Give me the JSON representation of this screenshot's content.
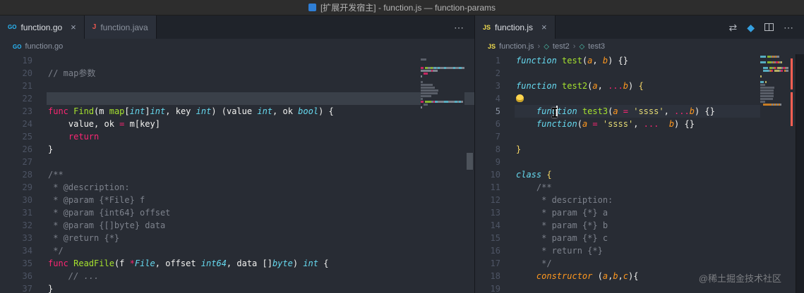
{
  "titlebar": {
    "title": "[扩展开发宿主] - function.js — function-params"
  },
  "watermark": "@稀土掘金技术社区",
  "glyphs": {
    "close": "×",
    "more": "⋯",
    "chevron": "›",
    "compare": "⇄",
    "diamond": "◆",
    "symbol": "◇",
    "go": "GO",
    "js": "JS",
    "java": "J"
  },
  "left": {
    "tabs": [
      {
        "label": "function.go"
      },
      {
        "label": "function.java"
      }
    ],
    "breadcrumb": {
      "file": "function.go"
    },
    "code": {
      "lines": [
        {
          "n": 19,
          "t": []
        },
        {
          "n": 20,
          "t": [
            [
              "// map参数",
              "cm"
            ]
          ]
        },
        {
          "n": 21,
          "t": []
        },
        {
          "n": 22,
          "hl": "sel",
          "t": []
        },
        {
          "n": 23,
          "t": [
            [
              "func",
              "k"
            ],
            [
              " ",
              "p"
            ],
            [
              "Find",
              "fn"
            ],
            [
              "(m ",
              "p"
            ],
            [
              "map",
              "fn"
            ],
            [
              "[",
              "p"
            ],
            [
              "int",
              "ty"
            ],
            [
              "]",
              "p"
            ],
            [
              "int",
              "ty"
            ],
            [
              ", key ",
              "p"
            ],
            [
              "int",
              "ty"
            ],
            [
              ") (value ",
              "p"
            ],
            [
              "int",
              "ty"
            ],
            [
              ", ok ",
              "p"
            ],
            [
              "bool",
              "ty"
            ],
            [
              ") {",
              "p"
            ]
          ]
        },
        {
          "n": 24,
          "t": [
            [
              "    value, ok ",
              "p"
            ],
            [
              "=",
              "k"
            ],
            [
              " m[key]",
              "p"
            ]
          ]
        },
        {
          "n": 25,
          "t": [
            [
              "    ",
              "p"
            ],
            [
              "return",
              "k"
            ]
          ]
        },
        {
          "n": 26,
          "t": [
            [
              "}",
              "p"
            ]
          ]
        },
        {
          "n": 27,
          "t": []
        },
        {
          "n": 28,
          "t": [
            [
              "/**",
              "cm"
            ]
          ]
        },
        {
          "n": 29,
          "t": [
            [
              " * @description:",
              "cm"
            ]
          ]
        },
        {
          "n": 30,
          "t": [
            [
              " * @param {*File} f",
              "cm"
            ]
          ]
        },
        {
          "n": 31,
          "t": [
            [
              " * @param {int64} offset",
              "cm"
            ]
          ]
        },
        {
          "n": 32,
          "t": [
            [
              " * @param {[]byte} data",
              "cm"
            ]
          ]
        },
        {
          "n": 33,
          "t": [
            [
              " * @return {*}",
              "cm"
            ]
          ]
        },
        {
          "n": 34,
          "t": [
            [
              " */",
              "cm"
            ]
          ]
        },
        {
          "n": 35,
          "t": [
            [
              "func",
              "k"
            ],
            [
              " ",
              "p"
            ],
            [
              "ReadFile",
              "fn"
            ],
            [
              "(f ",
              "p"
            ],
            [
              "*",
              "k"
            ],
            [
              "File",
              "ty"
            ],
            [
              ", offset ",
              "p"
            ],
            [
              "int64",
              "ty"
            ],
            [
              ", data []",
              "p"
            ],
            [
              "byte",
              "ty"
            ],
            [
              ") ",
              "p"
            ],
            [
              "int",
              "ty"
            ],
            [
              " {",
              "p"
            ]
          ]
        },
        {
          "n": 36,
          "t": [
            [
              "    ",
              "p"
            ],
            [
              "// ...",
              "cmi"
            ]
          ]
        },
        {
          "n": 37,
          "t": [
            [
              "}",
              "p"
            ]
          ]
        }
      ]
    }
  },
  "right": {
    "tab": {
      "label": "function.js"
    },
    "breadcrumb": {
      "file": "function.js",
      "sym1": "test2",
      "sym2": "test3"
    },
    "code": {
      "lines": [
        {
          "n": 1,
          "t": [
            [
              "function",
              "kwi"
            ],
            [
              " ",
              "p"
            ],
            [
              "test",
              "fn"
            ],
            [
              "(",
              "p"
            ],
            [
              "a",
              "pr"
            ],
            [
              ", ",
              "p"
            ],
            [
              "b",
              "pr"
            ],
            [
              ") {}",
              "p"
            ]
          ]
        },
        {
          "n": 2,
          "t": []
        },
        {
          "n": 3,
          "t": [
            [
              "function",
              "kwi"
            ],
            [
              " ",
              "p"
            ],
            [
              "test2",
              "fn"
            ],
            [
              "(",
              "p"
            ],
            [
              "a",
              "pr"
            ],
            [
              ", ",
              "p"
            ],
            [
              "...",
              "k"
            ],
            [
              "b",
              "pr"
            ],
            [
              ") ",
              "p"
            ],
            [
              "{",
              "y"
            ]
          ]
        },
        {
          "n": 4,
          "bulb": true,
          "t": []
        },
        {
          "n": 5,
          "hl": "cur",
          "t": [
            [
              "    ",
              "p"
            ],
            [
              "func",
              "kwi"
            ],
            [
              "",
              "cursor"
            ],
            [
              "tion",
              "kwi"
            ],
            [
              " ",
              "p"
            ],
            [
              "test3",
              "fn"
            ],
            [
              "(",
              "p"
            ],
            [
              "a ",
              "pr"
            ],
            [
              "=",
              "k"
            ],
            [
              " ",
              "p"
            ],
            [
              "'ssss'",
              "s"
            ],
            [
              ", ",
              "p"
            ],
            [
              "...",
              "k"
            ],
            [
              "b",
              "pr"
            ],
            [
              ") {}",
              "p"
            ]
          ]
        },
        {
          "n": 6,
          "t": [
            [
              "    ",
              "p"
            ],
            [
              "function",
              "kwi"
            ],
            [
              "(",
              "p"
            ],
            [
              "a ",
              "pr"
            ],
            [
              "=",
              "k"
            ],
            [
              " ",
              "p"
            ],
            [
              "'ssss'",
              "s"
            ],
            [
              ", ",
              "p"
            ],
            [
              "...",
              "k"
            ],
            [
              "  ",
              "p"
            ],
            [
              "b",
              "pr"
            ],
            [
              ") {}",
              "p"
            ]
          ]
        },
        {
          "n": 7,
          "t": []
        },
        {
          "n": 8,
          "t": [
            [
              "}",
              "y"
            ]
          ]
        },
        {
          "n": 9,
          "t": []
        },
        {
          "n": 10,
          "t": [
            [
              "class",
              "kwi"
            ],
            [
              " ",
              "p"
            ],
            [
              "{",
              "y"
            ]
          ]
        },
        {
          "n": 11,
          "t": [
            [
              "    /**",
              "cm"
            ]
          ]
        },
        {
          "n": 12,
          "t": [
            [
              "     * description:",
              "cm"
            ]
          ]
        },
        {
          "n": 13,
          "t": [
            [
              "     * param {*} a",
              "cm"
            ]
          ]
        },
        {
          "n": 14,
          "t": [
            [
              "     * param {*} b",
              "cm"
            ]
          ]
        },
        {
          "n": 15,
          "t": [
            [
              "     * param {*} c",
              "cm"
            ]
          ]
        },
        {
          "n": 16,
          "t": [
            [
              "     * return {*}",
              "cm"
            ]
          ]
        },
        {
          "n": 17,
          "t": [
            [
              "     */",
              "cm"
            ]
          ]
        },
        {
          "n": 18,
          "t": [
            [
              "    ",
              "p"
            ],
            [
              "constructor",
              "ctor"
            ],
            [
              " (",
              "p"
            ],
            [
              "a",
              "pr"
            ],
            [
              ",",
              "p"
            ],
            [
              "b",
              "pr"
            ],
            [
              ",",
              "p"
            ],
            [
              "c",
              "pr"
            ],
            [
              "){",
              "p"
            ]
          ]
        },
        {
          "n": 19,
          "t": []
        }
      ]
    }
  }
}
